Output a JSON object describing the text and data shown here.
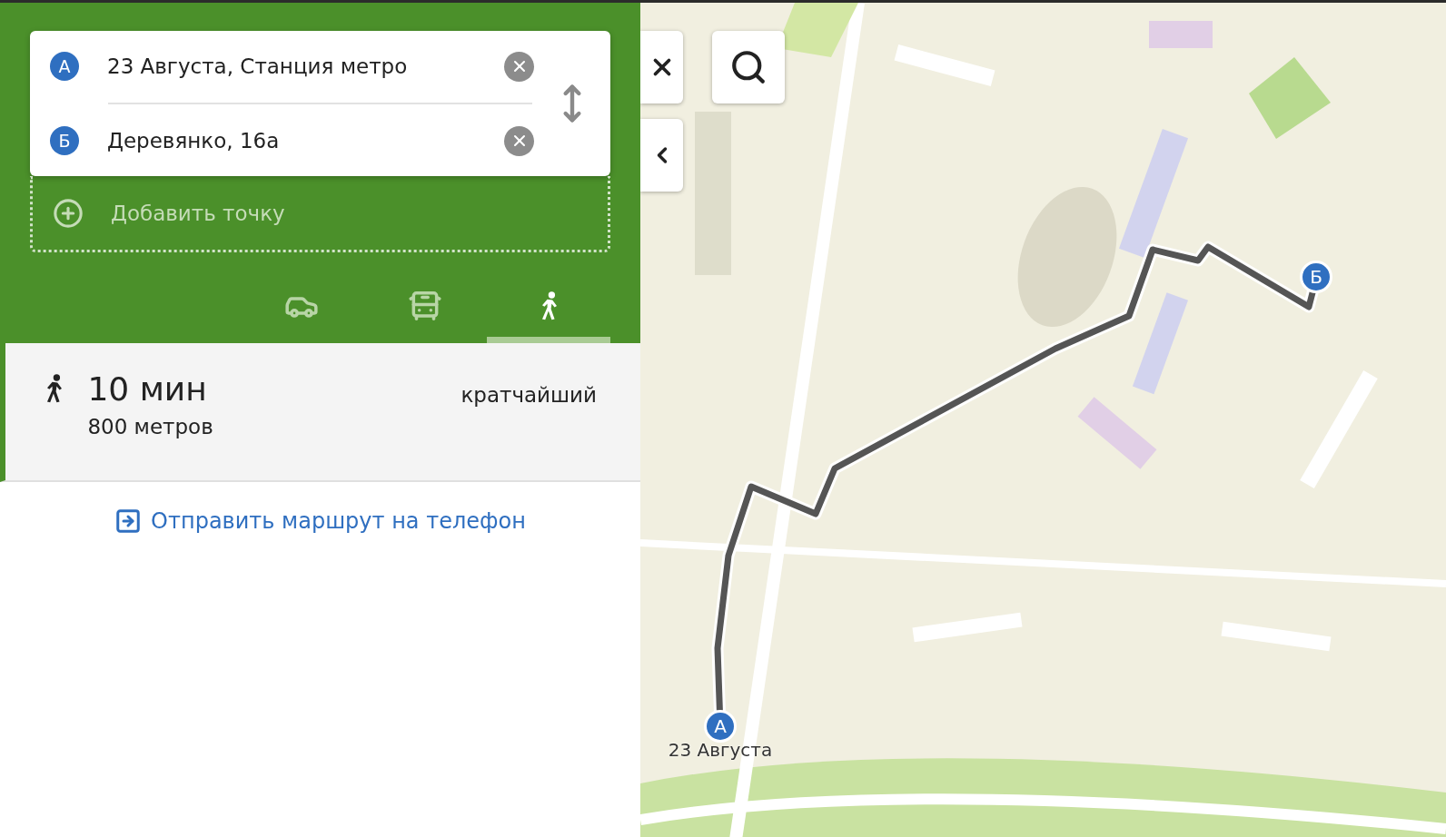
{
  "route_form": {
    "points": [
      {
        "marker": "А",
        "value": "23 Августа, Станция метро"
      },
      {
        "marker": "Б",
        "value": "Деревянко, 16а"
      }
    ],
    "add_point": "Добавить точку"
  },
  "modes": [
    {
      "kind": "car",
      "selected": false
    },
    {
      "kind": "bus",
      "selected": false
    },
    {
      "kind": "walk",
      "selected": true
    }
  ],
  "result": {
    "duration": "10 мин",
    "distance": "800 метров",
    "tag": "кратчайший"
  },
  "send_link": "Отправить маршрут на телефон",
  "map": {
    "kind": "picture",
    "markers": [
      {
        "letter": "А",
        "caption": "23 Августа"
      },
      {
        "letter": "Б"
      }
    ]
  }
}
